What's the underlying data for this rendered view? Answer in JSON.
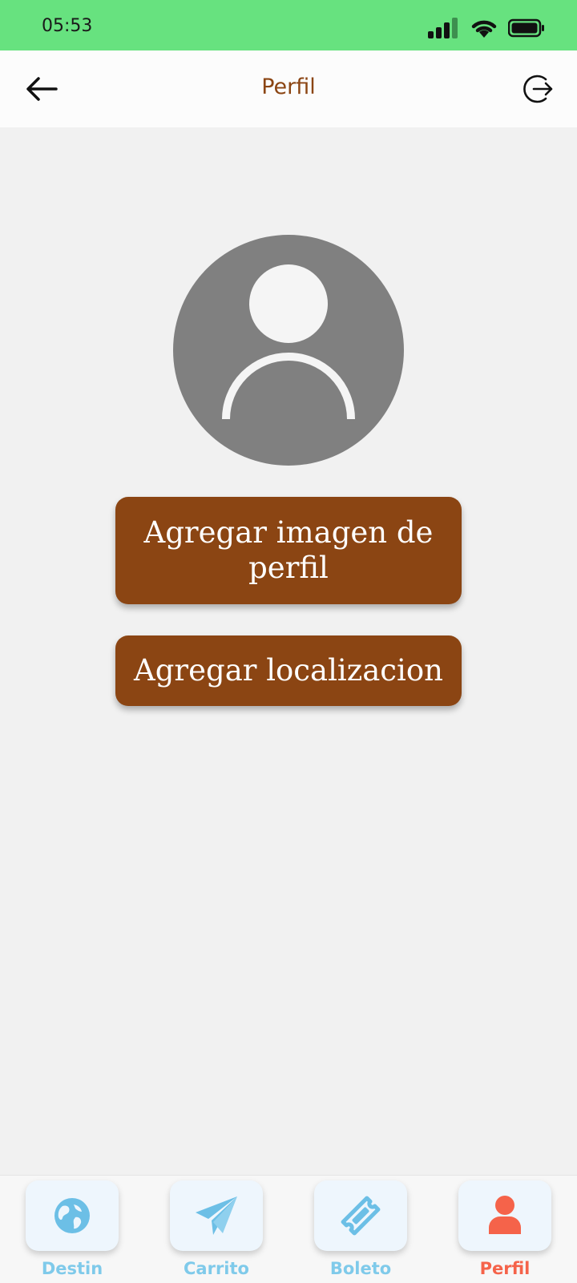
{
  "status_bar": {
    "time": "05:53"
  },
  "header": {
    "title": "Perfil"
  },
  "profile": {
    "add_image_label": "Agregar imagen de perfil",
    "add_location_label": "Agregar localizacion"
  },
  "bottom_nav": {
    "items": [
      {
        "label": "Destin",
        "icon": "globe-icon",
        "active": false
      },
      {
        "label": "Carrito",
        "icon": "paper-plane-icon",
        "active": false
      },
      {
        "label": "Boleto",
        "icon": "ticket-icon",
        "active": false
      },
      {
        "label": "Perfil",
        "icon": "person-icon",
        "active": true
      }
    ]
  },
  "colors": {
    "status_bar": "#67e27f",
    "accent": "#8b4513",
    "nav_inactive": "#7fcaea",
    "nav_active": "#f5634a",
    "avatar": "#808080"
  }
}
